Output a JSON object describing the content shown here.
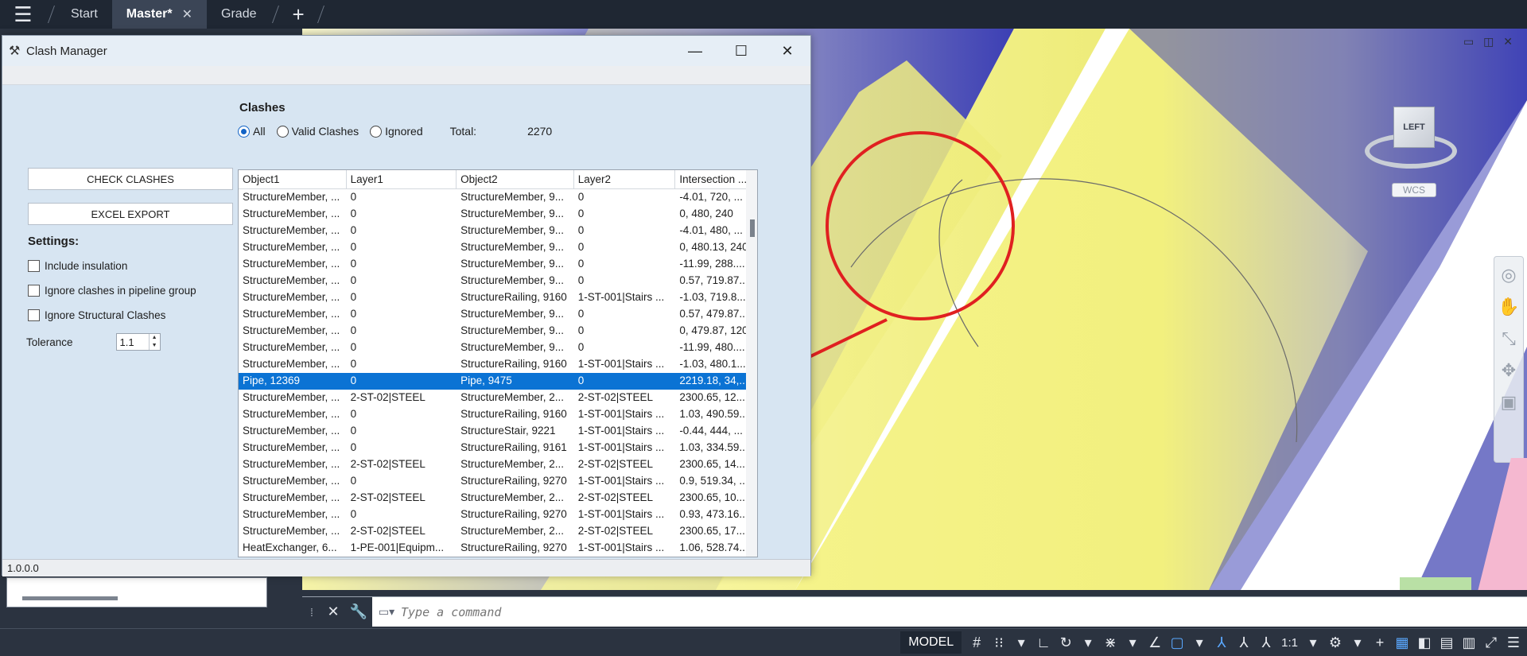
{
  "tabs": [
    {
      "label": "Start"
    },
    {
      "label": "Master*",
      "active": true
    },
    {
      "label": "Grade"
    }
  ],
  "dialog": {
    "title": "Clash Manager",
    "clashes_heading": "Clashes",
    "filters": {
      "all": "All",
      "valid": "Valid Clashes",
      "ignored": "Ignored",
      "selected": "All"
    },
    "total_label": "Total:",
    "total_value": "2270",
    "check_button": "CHECK CLASHES",
    "export_button": "EXCEL EXPORT",
    "settings_heading": "Settings:",
    "settings": {
      "include_insulation": "Include insulation",
      "ignore_pipeline": "Ignore clashes in pipeline group",
      "ignore_structural": "Ignore Structural Clashes"
    },
    "tolerance_label": "Tolerance",
    "tolerance_value": "1.1",
    "version": "1.0.0.0",
    "table": {
      "columns": [
        "Object1",
        "Layer1",
        "Object2",
        "Layer2",
        "Intersection ..."
      ],
      "rows": [
        [
          "StructureMember, ...",
          "0",
          "StructureMember, 9...",
          "0",
          "-4.01, 720, ..."
        ],
        [
          "StructureMember, ...",
          "0",
          "StructureMember, 9...",
          "0",
          "0, 480, 240"
        ],
        [
          "StructureMember, ...",
          "0",
          "StructureMember, 9...",
          "0",
          "-4.01, 480, ..."
        ],
        [
          "StructureMember, ...",
          "0",
          "StructureMember, 9...",
          "0",
          "0, 480.13, 240"
        ],
        [
          "StructureMember, ...",
          "0",
          "StructureMember, 9...",
          "0",
          "-11.99, 288...."
        ],
        [
          "StructureMember, ...",
          "0",
          "StructureMember, 9...",
          "0",
          "0.57, 719.87..."
        ],
        [
          "StructureMember, ...",
          "0",
          "StructureRailing, 9160",
          "1-ST-001|Stairs ...",
          "-1.03, 719.8..."
        ],
        [
          "StructureMember, ...",
          "0",
          "StructureMember, 9...",
          "0",
          "0.57, 479.87..."
        ],
        [
          "StructureMember, ...",
          "0",
          "StructureMember, 9...",
          "0",
          "0, 479.87, 120"
        ],
        [
          "StructureMember, ...",
          "0",
          "StructureMember, 9...",
          "0",
          "-11.99, 480...."
        ],
        [
          "StructureMember, ...",
          "0",
          "StructureRailing, 9160",
          "1-ST-001|Stairs ...",
          "-1.03, 480.1..."
        ],
        [
          "Pipe, 12369",
          "0",
          "Pipe, 9475",
          "0",
          "2219.18, 34,..."
        ],
        [
          "StructureMember, ...",
          "2-ST-02|STEEL",
          "StructureMember, 2...",
          "2-ST-02|STEEL",
          "2300.65, 12..."
        ],
        [
          "StructureMember, ...",
          "0",
          "StructureRailing, 9160",
          "1-ST-001|Stairs ...",
          "1.03, 490.59..."
        ],
        [
          "StructureMember, ...",
          "0",
          "StructureStair, 9221",
          "1-ST-001|Stairs ...",
          "-0.44, 444, ..."
        ],
        [
          "StructureMember, ...",
          "0",
          "StructureRailing, 9161",
          "1-ST-001|Stairs ...",
          "1.03, 334.59..."
        ],
        [
          "StructureMember, ...",
          "2-ST-02|STEEL",
          "StructureMember, 2...",
          "2-ST-02|STEEL",
          "2300.65, 14..."
        ],
        [
          "StructureMember, ...",
          "0",
          "StructureRailing, 9270",
          "1-ST-001|Stairs ...",
          "0.9, 519.34, ..."
        ],
        [
          "StructureMember, ...",
          "2-ST-02|STEEL",
          "StructureMember, 2...",
          "2-ST-02|STEEL",
          "2300.65, 10..."
        ],
        [
          "StructureMember, ...",
          "0",
          "StructureRailing, 9270",
          "1-ST-001|Stairs ...",
          "0.93, 473.16..."
        ],
        [
          "StructureMember, ...",
          "2-ST-02|STEEL",
          "StructureMember, 2...",
          "2-ST-02|STEEL",
          "2300.65, 17..."
        ],
        [
          "HeatExchanger, 6...",
          "1-PE-001|Equipm...",
          "StructureRailing, 9270",
          "1-ST-001|Stairs ...",
          "1.06, 528.74..."
        ]
      ],
      "selected_row": 11
    }
  },
  "viewcube": {
    "face": "LEFT",
    "wcs": "WCS"
  },
  "command": {
    "placeholder": "Type a command"
  },
  "statusbar": {
    "model": "MODEL",
    "scale": "1:1"
  }
}
